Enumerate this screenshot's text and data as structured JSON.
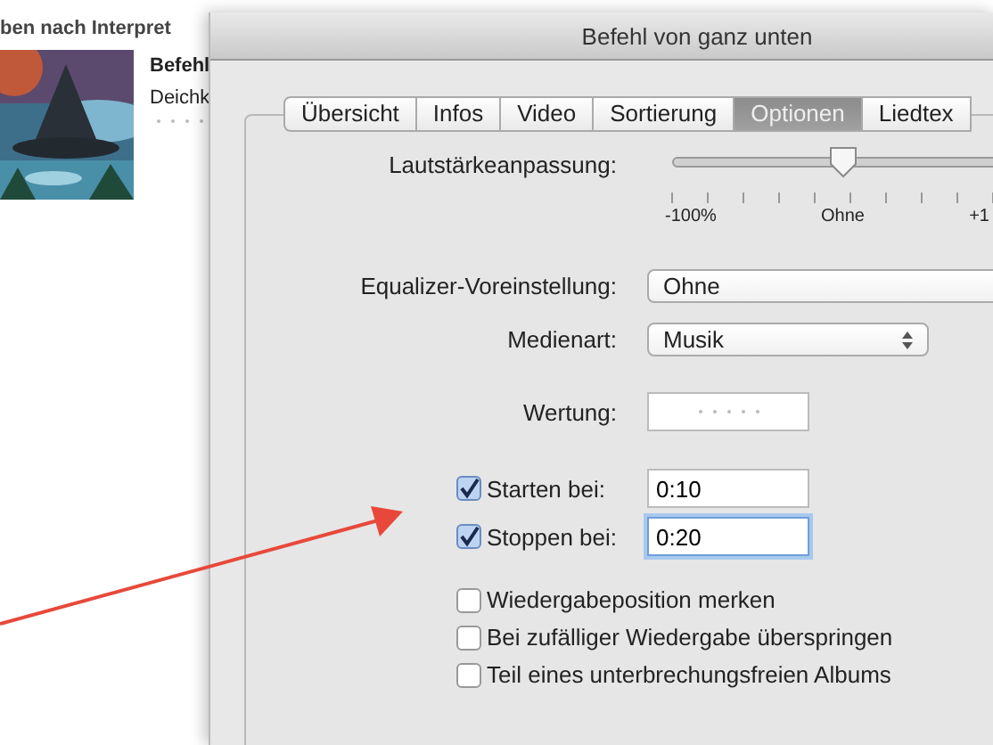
{
  "library": {
    "header": "ben nach Interpret",
    "album": {
      "title": "Befehl",
      "artist": "Deichk"
    }
  },
  "dialog": {
    "title": "Befehl von ganz unten",
    "tabs": [
      {
        "label": "Übersicht",
        "selected": false
      },
      {
        "label": "Infos",
        "selected": false
      },
      {
        "label": "Video",
        "selected": false
      },
      {
        "label": "Sortierung",
        "selected": false
      },
      {
        "label": "Optionen",
        "selected": true
      },
      {
        "label": "Liedtex",
        "selected": false
      }
    ],
    "volume": {
      "label": "Lautstärkeanpassung:",
      "level": 0.5,
      "scale": [
        "-100%",
        "Ohne",
        "+1"
      ]
    },
    "equalizer": {
      "label": "Equalizer-Voreinstellung:",
      "value": "Ohne"
    },
    "media_kind": {
      "label": "Medienart:",
      "value": "Musik"
    },
    "rating": {
      "label": "Wertung:"
    },
    "times": [
      {
        "label": "Starten bei:",
        "checked": true,
        "value": "0:10",
        "focused": false
      },
      {
        "label": "Stoppen bei:",
        "checked": true,
        "value": "0:20",
        "focused": true
      }
    ],
    "options": [
      {
        "label": "Wiedergabeposition merken",
        "checked": false
      },
      {
        "label": "Bei zufälliger Wiedergabe überspringen",
        "checked": false
      },
      {
        "label": "Teil eines unterbrechungsfreien Albums",
        "checked": false
      }
    ]
  }
}
